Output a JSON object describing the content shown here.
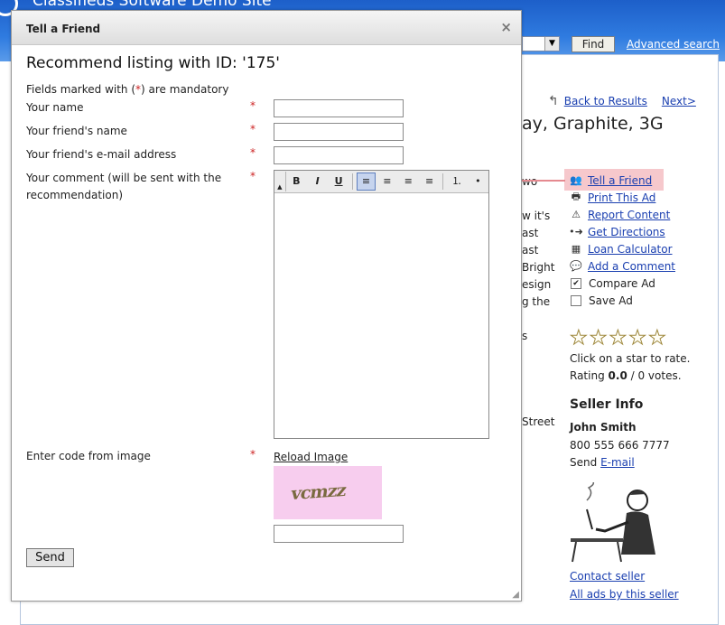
{
  "site": {
    "title": "Classifieds Software Demo Site",
    "find_label": "Find",
    "advanced_search": "Advanced search"
  },
  "listing": {
    "back_to_results": "Back to Results",
    "next": "Next>",
    "title_fragment": "ay, Graphite, 3G",
    "partial_lines": [
      "wo",
      "",
      "w it's",
      "ast",
      "ast",
      "Bright",
      "esign",
      "g the",
      "",
      "s",
      "",
      "",
      "",
      "",
      "Street"
    ]
  },
  "actions": {
    "tell_a_friend": "Tell a Friend",
    "print_this_ad": "Print This Ad",
    "report_content": "Report Content",
    "get_directions": "Get Directions",
    "loan_calculator": "Loan Calculator",
    "add_a_comment": "Add a Comment",
    "compare_ad": "Compare Ad",
    "save_ad": "Save Ad",
    "compare_checked": true,
    "save_checked": false
  },
  "rating": {
    "stars_total": 5,
    "stars_filled": 0,
    "click_text": "Click on a star to rate.",
    "rating_prefix": "Rating",
    "rating_value": "0.0",
    "votes_text": "/ 0 votes."
  },
  "seller": {
    "heading": "Seller Info",
    "name": "John Smith",
    "phone": "800 555 666 7777",
    "send_prefix": "Send",
    "email_link": "E-mail",
    "contact_seller": "Contact seller",
    "all_ads": "All ads by this seller"
  },
  "dialog": {
    "title": "Tell a Friend",
    "close": "×",
    "heading": "Recommend listing with ID: '175'",
    "mandatory_pre": "Fields marked with (",
    "mandatory_star": "*",
    "mandatory_post": ") are mandatory",
    "fields": {
      "your_name": "Your name",
      "friend_name": "Your friend's name",
      "friend_email": "Your friend's e-mail address",
      "comment": "Your comment (will be sent with the recommendation)",
      "code": "Enter code from image"
    },
    "required_mark": "*",
    "inputs": {
      "your_name_value": "",
      "friend_name_value": "",
      "friend_email_value": "",
      "comment_value": "",
      "code_value": ""
    },
    "toolbar": {
      "bold": "B",
      "italic": "I",
      "underline": "U",
      "align_left": "≡",
      "align_center": "≡",
      "align_right": "≡",
      "justify": "≡",
      "ordered_list": "⒈",
      "unordered_list": "•"
    },
    "reload_image": "Reload Image",
    "captcha_text": "vcmzz",
    "send": "Send"
  },
  "colors": {
    "header_blue": "#2f7be0",
    "highlight_pink": "#f6c8cc",
    "captcha_pink": "#f7cdee",
    "link_blue": "#1a3fb0",
    "required_red": "#cc2222"
  }
}
